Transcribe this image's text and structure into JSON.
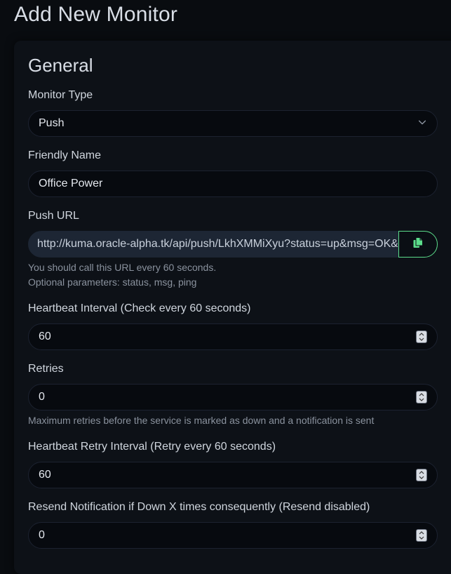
{
  "page": {
    "title": "Add New Monitor"
  },
  "general": {
    "title": "General",
    "monitor_type": {
      "label": "Monitor Type",
      "value": "Push"
    },
    "friendly_name": {
      "label": "Friendly Name",
      "value": "Office Power"
    },
    "push_url": {
      "label": "Push URL",
      "value": "http://kuma.oracle-alpha.tk/api/push/LkhXMMiXyu?status=up&msg=OK&ping=",
      "help_line1": "You should call this URL every 60 seconds.",
      "help_line2": "Optional parameters: status, msg, ping",
      "copy_icon": "copy-icon"
    },
    "heartbeat_interval": {
      "label": "Heartbeat Interval (Check every 60 seconds)",
      "value": "60"
    },
    "retries": {
      "label": "Retries",
      "value": "0",
      "help": "Maximum retries before the service is marked as down and a notification is sent"
    },
    "retry_interval": {
      "label": "Heartbeat Retry Interval (Retry every 60 seconds)",
      "value": "60"
    },
    "resend": {
      "label": "Resend Notification if Down X times consequently (Resend disabled)",
      "value": "0"
    }
  },
  "colors": {
    "background": "#090c10",
    "card": "#0d1117",
    "accent": "#5cdd8b",
    "url_field": "#1d2634"
  }
}
